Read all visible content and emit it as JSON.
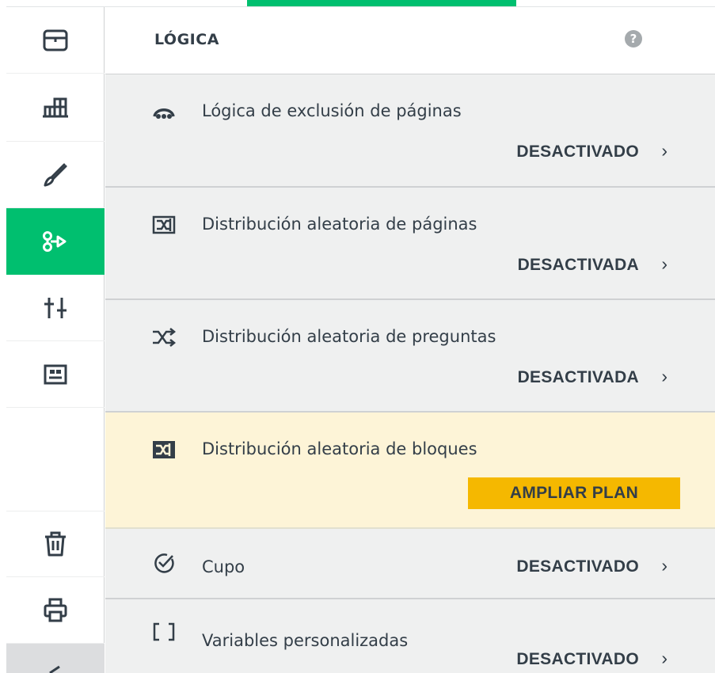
{
  "panel": {
    "title": "LÓGICA",
    "help_glyph": "?"
  },
  "sidebar": {
    "items": [
      {
        "icon": "survey-summary-icon",
        "active": false
      },
      {
        "icon": "build-survey-icon",
        "active": false
      },
      {
        "icon": "design-brush-icon",
        "active": false
      },
      {
        "icon": "logic-icon",
        "active": true
      },
      {
        "icon": "options-sliders-icon",
        "active": false
      },
      {
        "icon": "question-bank-icon",
        "active": false
      },
      {
        "icon": "trash-icon",
        "active": false
      },
      {
        "icon": "print-icon",
        "active": false
      },
      {
        "icon": "collapse-icon",
        "active": false
      }
    ]
  },
  "logic_items": [
    {
      "icon": "page-skip-logic-icon",
      "label": "Lógica de exclusión de páginas",
      "status": "DESACTIVADO"
    },
    {
      "icon": "page-randomization-icon",
      "label": "Distribución aleatoria de páginas",
      "status": "DESACTIVADA"
    },
    {
      "icon": "question-randomization-icon",
      "label": "Distribución aleatoria de preguntas",
      "status": "DESACTIVADA"
    },
    {
      "icon": "block-randomization-icon",
      "label": "Distribución aleatoria de bloques",
      "action": "AMPLIAR PLAN"
    },
    {
      "icon": "quota-icon",
      "label": "Cupo",
      "status": "DESACTIVADO"
    },
    {
      "icon": "custom-variables-icon",
      "label": "Variables personalizadas",
      "status": "DESACTIVADO"
    }
  ],
  "chevron": "›",
  "colors": {
    "accent_green": "#00bf6f",
    "upgrade_yellow": "#f5b800",
    "upgrade_row_bg": "#fdf4d7",
    "row_bg": "#eff0f0",
    "text": "#333e48"
  }
}
